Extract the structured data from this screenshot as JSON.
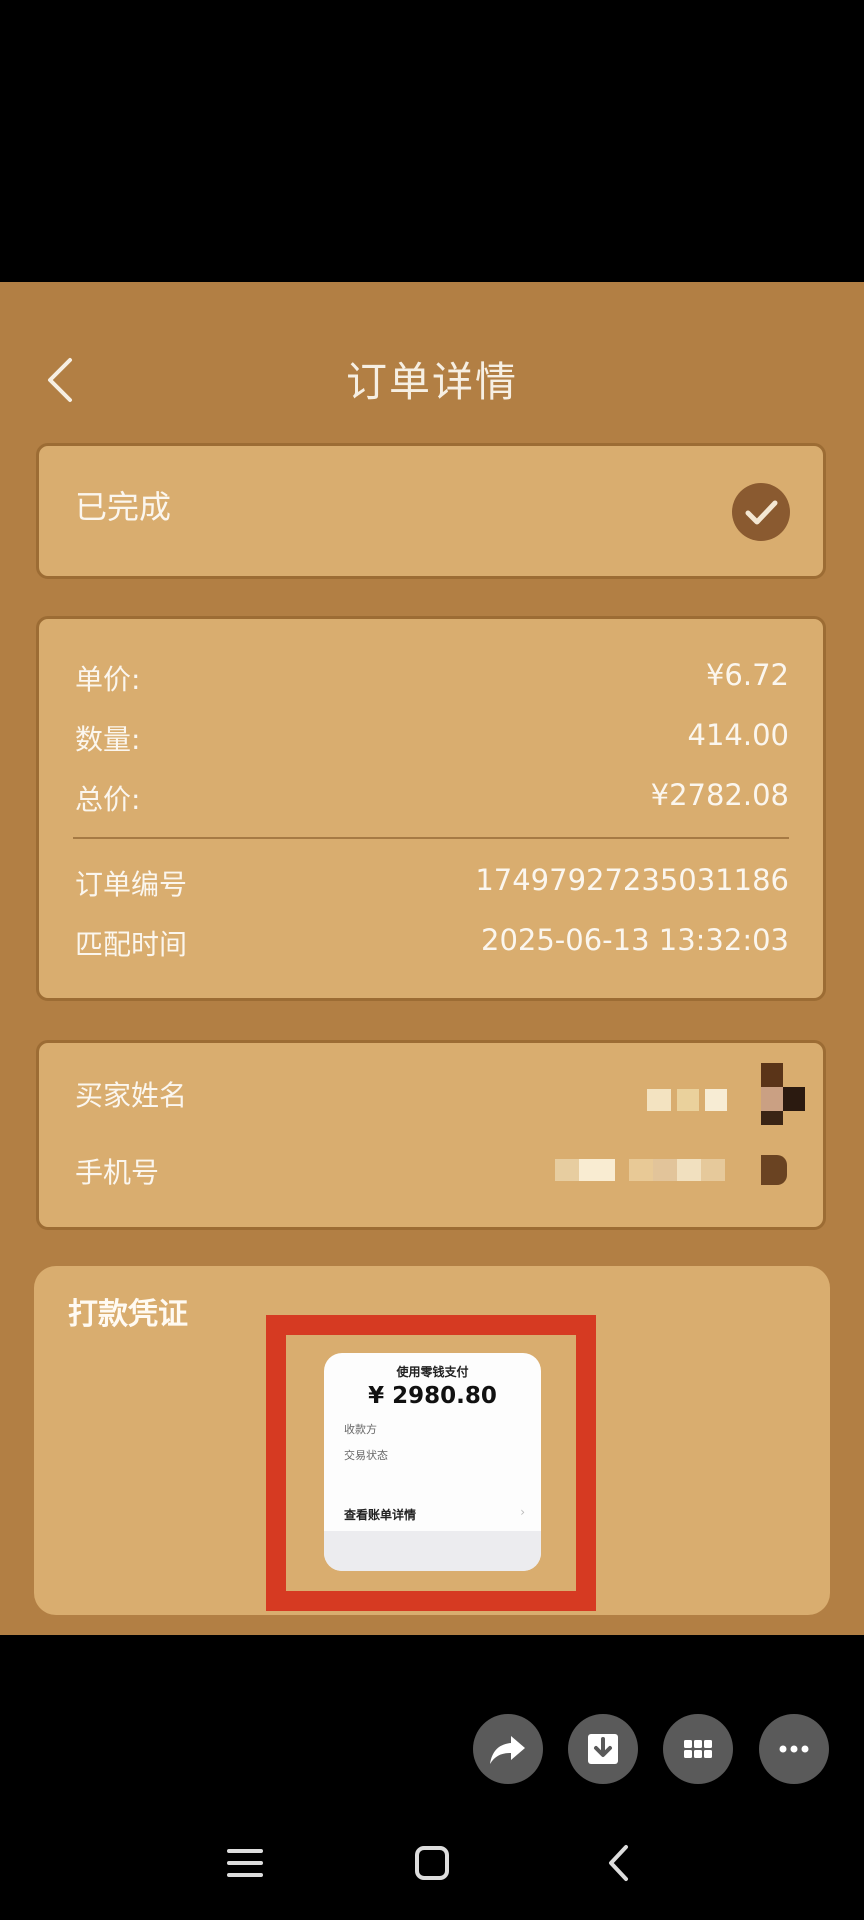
{
  "header": {
    "title": "订单详情"
  },
  "status": {
    "text": "已完成"
  },
  "order": {
    "rows": [
      {
        "label": "单价:",
        "value": "¥6.72"
      },
      {
        "label": "数量:",
        "value": "414.00"
      },
      {
        "label": "总价:",
        "value": "¥2782.08"
      },
      {
        "label": "订单编号",
        "value": "17497927235031186"
      },
      {
        "label": "匹配时间",
        "value": "2025-06-13 13:32:03"
      }
    ]
  },
  "buyer": {
    "name_label": "买家姓名",
    "phone_label": "手机号"
  },
  "voucher": {
    "title": "打款凭证",
    "receipt": {
      "top_label": "使用零钱支付",
      "amount": "¥ 2980.80",
      "payee_label": "收款方",
      "status_label": "交易状态",
      "detail_link": "查看账单详情",
      "chevron": "›"
    }
  },
  "actions": [
    "share-icon",
    "download-icon",
    "grid-icon",
    "more-icon"
  ],
  "system_nav": [
    "menu-icon",
    "home-icon",
    "back-icon"
  ],
  "colors": {
    "screen_bg": "#b27f44",
    "card_bg": "#d9ad6f",
    "card_border": "#9c6c34",
    "check_circle": "#8a5a30",
    "highlight": "#d63a22"
  }
}
